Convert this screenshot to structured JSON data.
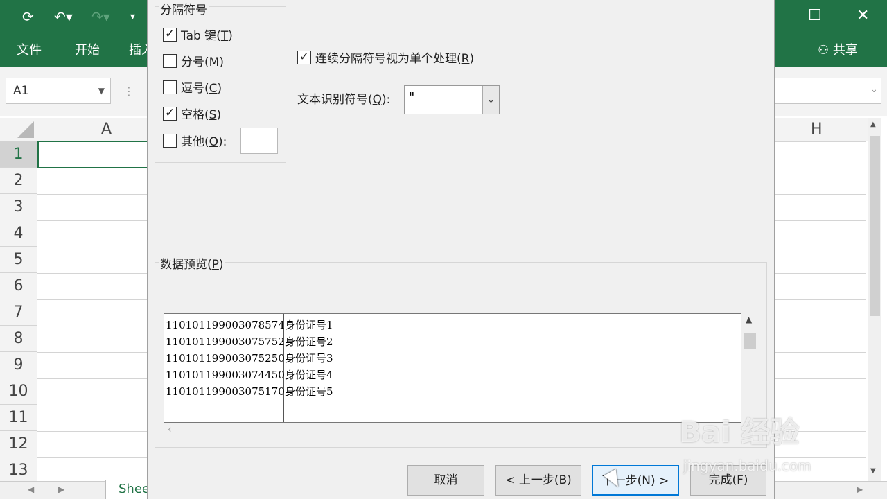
{
  "excel": {
    "tabs": [
      "文件",
      "开始",
      "插入"
    ],
    "share_label": "共享",
    "name_box": "A1",
    "columns": [
      "A",
      "H"
    ],
    "rows": [
      "1",
      "2",
      "3",
      "4",
      "5",
      "6",
      "7",
      "8",
      "9",
      "10",
      "11",
      "12",
      "13"
    ],
    "sheet_tab": "Shee",
    "brand_color": "#217346"
  },
  "dialog": {
    "delimiters_group": "分隔符号",
    "delimiters": [
      {
        "label": "Tab 键(",
        "key": "T",
        "suffix": ")",
        "checked": true
      },
      {
        "label": "分号(",
        "key": "M",
        "suffix": ")",
        "checked": false
      },
      {
        "label": "逗号(",
        "key": "C",
        "suffix": ")",
        "checked": false
      },
      {
        "label": "空格(",
        "key": "S",
        "suffix": ")",
        "checked": true
      },
      {
        "label": "其他(",
        "key": "O",
        "suffix": "):",
        "checked": false
      }
    ],
    "consecutive": {
      "label": "连续分隔符号视为单个处理(",
      "key": "R",
      "suffix": ")",
      "checked": true
    },
    "qualifier": {
      "label": "文本识别符号(",
      "key": "Q",
      "suffix": "):",
      "value": "\""
    },
    "preview_group": {
      "label": "数据预览(",
      "key": "P",
      "suffix": ")"
    },
    "preview_rows": [
      {
        "id": "110101199003078574",
        "name": "身份证号1"
      },
      {
        "id": "110101199003075752",
        "name": "身份证号2"
      },
      {
        "id": "110101199003075250",
        "name": "身份证号3"
      },
      {
        "id": "110101199003074450",
        "name": "身份证号4"
      },
      {
        "id": "110101199003075170",
        "name": "身份证号5"
      }
    ],
    "buttons": {
      "cancel": "取消",
      "back": "< 上一步(B)",
      "next": "下一步(N) >",
      "finish": "完成(F)"
    }
  },
  "watermark": {
    "main": "Bai 经验",
    "sub": "jingyan.baidu.com"
  }
}
